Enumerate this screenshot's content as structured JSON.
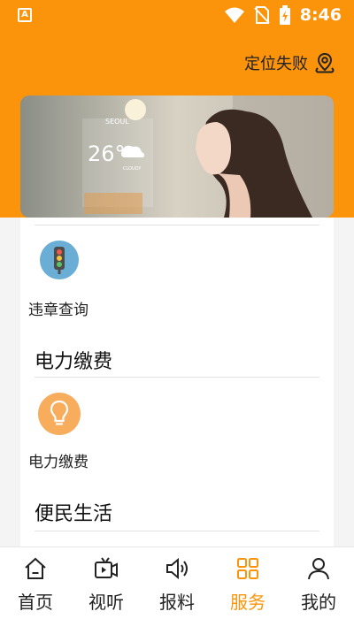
{
  "status_bar": {
    "app_badge": "A",
    "time": "8:46"
  },
  "header": {
    "location_text": "定位失败"
  },
  "banner": {
    "city": "SEOUL",
    "temp": "26°",
    "condition": "CLOUDY"
  },
  "services": [
    {
      "label": "违章查询",
      "icon": "traffic-light-icon",
      "color": "#6aaed6"
    }
  ],
  "sections": [
    {
      "title": "电力缴费",
      "items": [
        {
          "label": "电力缴费",
          "icon": "lightbulb-icon",
          "color": "#f8ad5d"
        }
      ]
    },
    {
      "title": "便民生活"
    }
  ],
  "tabs": [
    {
      "label": "首页",
      "icon": "home-icon"
    },
    {
      "label": "视听",
      "icon": "video-icon"
    },
    {
      "label": "报料",
      "icon": "speaker-icon"
    },
    {
      "label": "服务",
      "icon": "grid-icon",
      "active": true
    },
    {
      "label": "我的",
      "icon": "user-icon"
    }
  ],
  "colors": {
    "accent": "#fb940b",
    "traffic_icon_bg": "#6aaed6",
    "bulb_icon_bg": "#f8ad5d"
  }
}
